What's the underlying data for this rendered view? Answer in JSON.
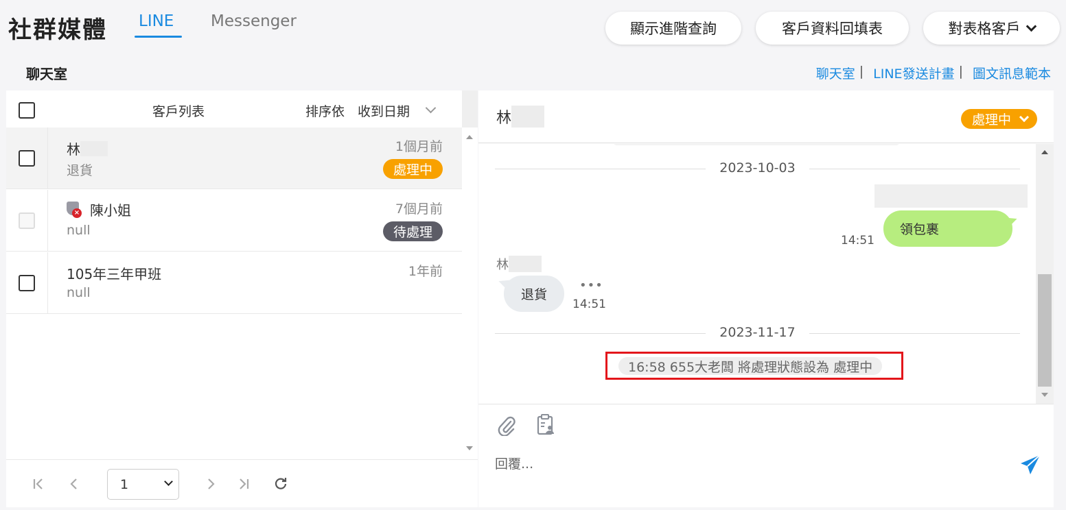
{
  "header": {
    "title": "社群媒體",
    "tabs": [
      {
        "label": "LINE",
        "active": true
      },
      {
        "label": "Messenger",
        "active": false
      }
    ],
    "buttons": {
      "advanced_query": "顯示進階查詢",
      "customer_form": "客戶資料回填表",
      "spreadsheet_customer": "對表格客戶"
    }
  },
  "section": {
    "label": "聊天室",
    "links": [
      "聊天室",
      "LINE發送計畫",
      "圖文訊息範本"
    ],
    "link_separator": "|"
  },
  "customer_list": {
    "header": "客戶列表",
    "sort_label": "排序依",
    "sort_value": "收到日期",
    "rows": [
      {
        "name": "林",
        "subtitle": "退貨",
        "time": "1個月前",
        "badge": "處理中",
        "badge_color": "#f8a100",
        "selected": true,
        "blocked": false
      },
      {
        "name": "陳小姐",
        "subtitle": "null",
        "time": "7個月前",
        "badge": "待處理",
        "badge_color": "#5c5c66",
        "selected": false,
        "blocked": true
      },
      {
        "name": "105年三年甲班",
        "subtitle": "null",
        "time": "1年前",
        "badge": "",
        "selected": false,
        "blocked": false
      }
    ],
    "pager": {
      "current_page": "1"
    }
  },
  "chat": {
    "contact_name": "林",
    "status": "處理中",
    "status_color": "#f8a100",
    "messages": {
      "date_1": "2023-10-03",
      "outgoing_text": "領包裹",
      "outgoing_time": "14:51",
      "incoming_sender": "林",
      "incoming_text": "退貨",
      "incoming_dots": "•••",
      "incoming_time": "14:51",
      "date_2": "2023-11-17",
      "status_log": "16:58  655大老闆 將處理狀態設為 處理中"
    },
    "reply_placeholder": "回覆..."
  },
  "colors": {
    "accent": "#1a8ae0",
    "highlight_border": "#e3161b",
    "outgoing_bubble": "#b7ed7f",
    "incoming_bubble": "#e9ecef"
  }
}
